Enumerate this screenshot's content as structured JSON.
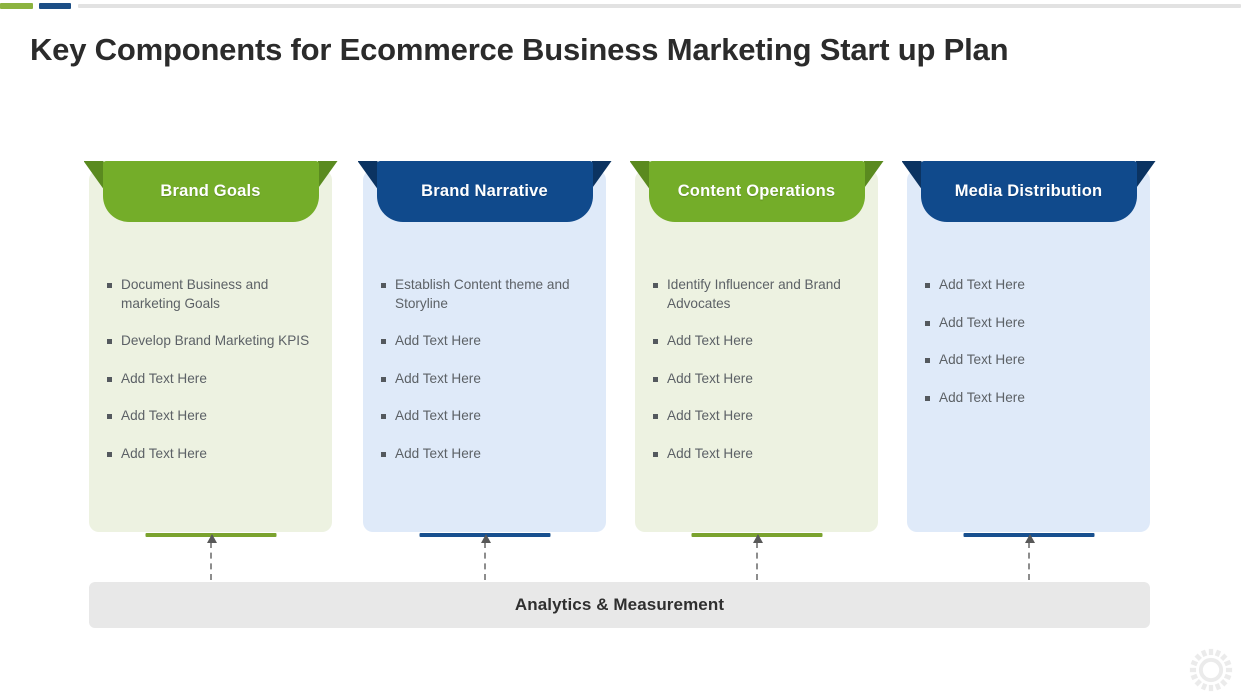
{
  "topbar": {
    "segments": [
      {
        "name": "green",
        "color": "#8cb33f"
      },
      {
        "name": "blue",
        "color": "#1c4e86"
      },
      {
        "name": "grey",
        "color": "#e2e2e2"
      }
    ]
  },
  "page_title": "Key Components for Ecommerce Business Marketing Start up Plan",
  "cards": [
    {
      "header": "Brand Goals",
      "theme": "green",
      "header_color": "#74ad29",
      "body_color": "#edf2e1",
      "underline_color": "#7ba32e",
      "bullets": [
        "Document Business and marketing Goals",
        "Develop Brand Marketing KPIS",
        "Add Text Here",
        "Add Text Here",
        "Add Text Here"
      ]
    },
    {
      "header": "Brand Narrative",
      "theme": "blue",
      "header_color": "#104a8c",
      "body_color": "#dfeaf9",
      "underline_color": "#18508f",
      "bullets": [
        "Establish Content theme and Storyline",
        "Add Text Here",
        "Add Text Here",
        "Add Text Here",
        "Add Text Here"
      ]
    },
    {
      "header": "Content Operations",
      "theme": "green",
      "header_color": "#74ad29",
      "body_color": "#edf2e1",
      "underline_color": "#7ba32e",
      "bullets": [
        "Identify Influencer  and Brand Advocates",
        "Add Text Here",
        "Add Text Here",
        "Add Text Here",
        "Add Text Here"
      ]
    },
    {
      "header": "Media Distribution",
      "theme": "blue",
      "header_color": "#104a8c",
      "body_color": "#dfeaf9",
      "underline_color": "#18508f",
      "bullets": [
        "Add Text Here",
        "Add Text Here",
        "Add Text Here",
        "Add Text Here"
      ]
    }
  ],
  "footer": {
    "label": "Analytics & Measurement"
  },
  "watermark": {
    "icon": "gear-icon"
  }
}
